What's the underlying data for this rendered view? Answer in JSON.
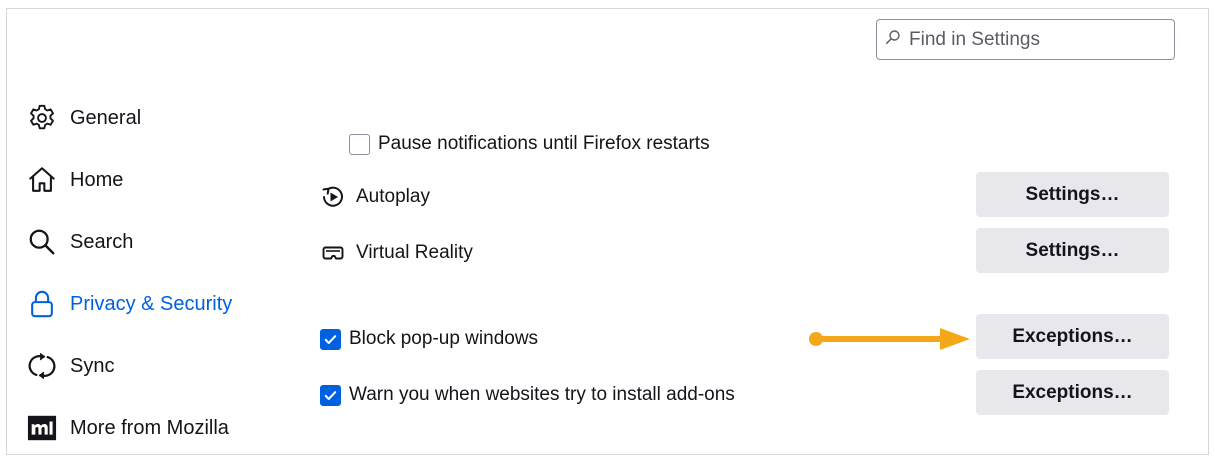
{
  "search": {
    "placeholder": "Find in Settings"
  },
  "sidebar": {
    "items": [
      {
        "label": "General",
        "icon": "gear-icon"
      },
      {
        "label": "Home",
        "icon": "home-icon"
      },
      {
        "label": "Search",
        "icon": "search-icon"
      },
      {
        "label": "Privacy & Security",
        "icon": "lock-icon",
        "active": true
      },
      {
        "label": "Sync",
        "icon": "sync-icon"
      },
      {
        "label": "More from Mozilla",
        "icon": "mozilla-icon"
      }
    ]
  },
  "main": {
    "pause_notifications": {
      "label": "Pause notifications until Firefox restarts",
      "checked": false
    },
    "autoplay": {
      "label": "Autoplay",
      "button": "Settings…"
    },
    "virtual_reality": {
      "label": "Virtual Reality",
      "button": "Settings…"
    },
    "block_popups": {
      "label": "Block pop-up windows",
      "checked": true,
      "button": "Exceptions…"
    },
    "warn_addons": {
      "label": "Warn you when websites try to install add-ons",
      "checked": true,
      "button": "Exceptions…"
    }
  },
  "colors": {
    "accent": "#0061e0",
    "arrow": "#f4a819",
    "button_bg": "#e8e8ec"
  }
}
